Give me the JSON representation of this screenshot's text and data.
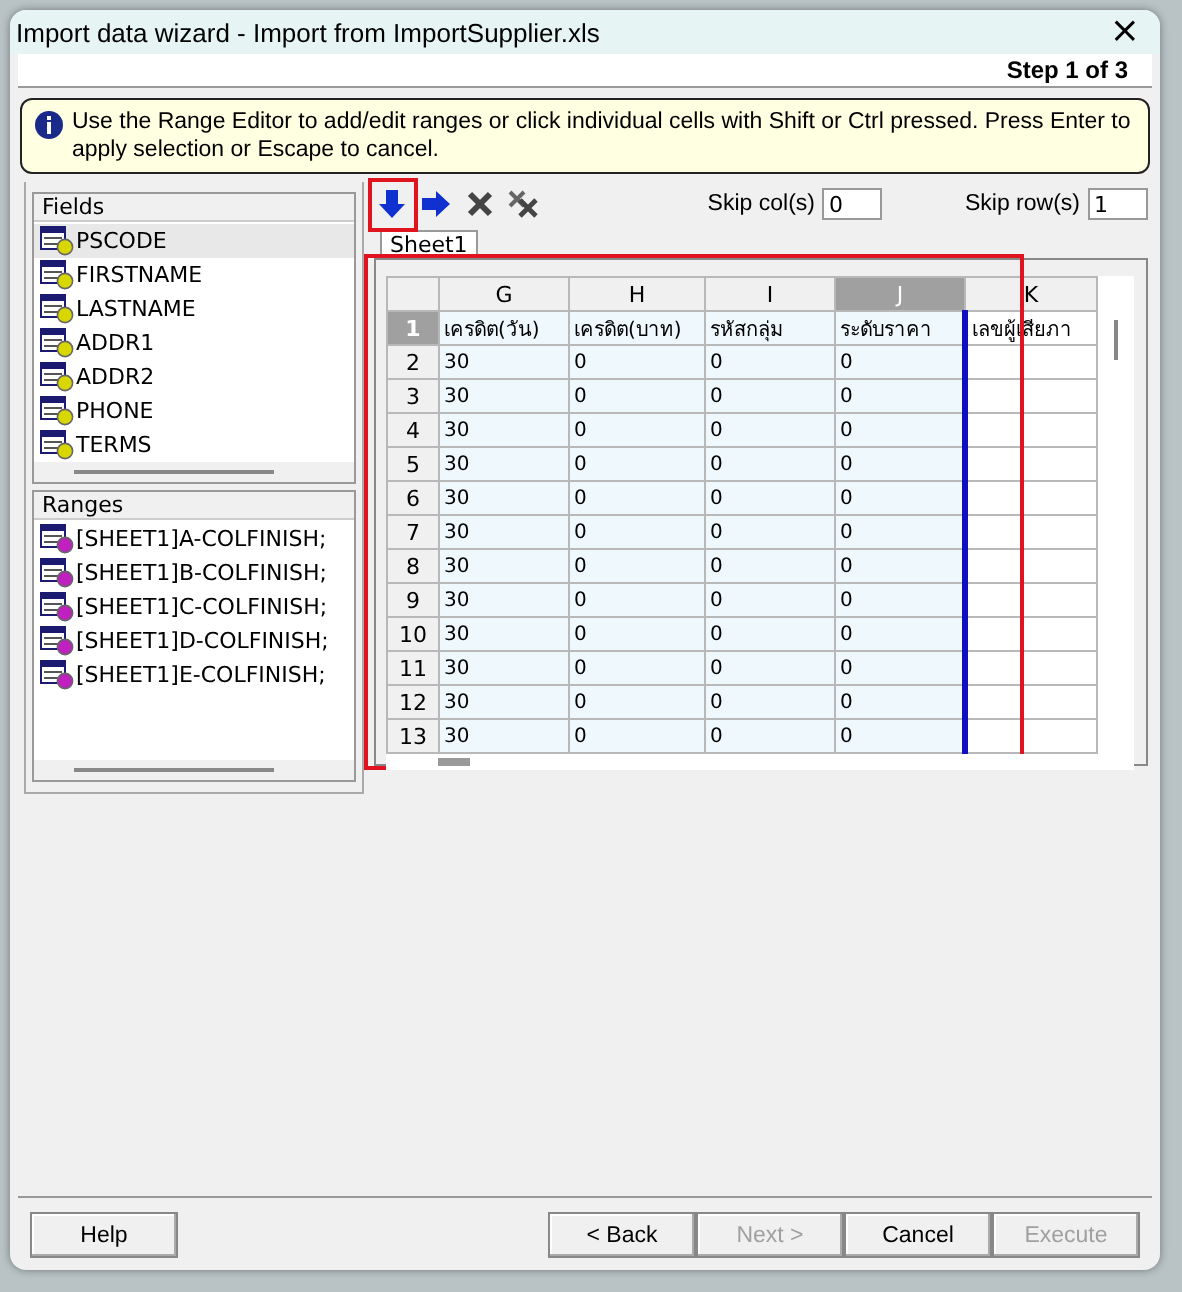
{
  "window": {
    "title": "Import data wizard - Import from ImportSupplier.xls",
    "close": "×"
  },
  "step": "Step 1 of 3",
  "info": "Use the Range Editor to add/edit ranges or click individual cells with Shift or Ctrl pressed. Press Enter to apply selection or Escape to cancel.",
  "fields": {
    "title": "Fields",
    "items": [
      {
        "label": "PSCODE",
        "selected": true
      },
      {
        "label": "FIRSTNAME",
        "selected": false
      },
      {
        "label": "LASTNAME",
        "selected": false
      },
      {
        "label": "ADDR1",
        "selected": false
      },
      {
        "label": "ADDR2",
        "selected": false
      },
      {
        "label": "PHONE",
        "selected": false
      },
      {
        "label": "TERMS",
        "selected": false
      }
    ]
  },
  "ranges": {
    "title": "Ranges",
    "items": [
      "[SHEET1]A-COLFINISH;",
      "[SHEET1]B-COLFINISH;",
      "[SHEET1]C-COLFINISH;",
      "[SHEET1]D-COLFINISH;",
      "[SHEET1]E-COLFINISH;"
    ]
  },
  "toolbar": {
    "skip_cols": {
      "label": "Skip col(s)",
      "value": "0"
    },
    "skip_rows": {
      "label": "Skip row(s)",
      "value": "1"
    }
  },
  "sheet_tabs": [
    {
      "label": "Sheet1",
      "selected": true
    }
  ],
  "grid": {
    "columns": [
      {
        "label": "G",
        "selected": false,
        "in_range": true
      },
      {
        "label": "H",
        "selected": false,
        "in_range": true
      },
      {
        "label": "I",
        "selected": false,
        "in_range": true
      },
      {
        "label": "J",
        "selected": true,
        "in_range": true
      },
      {
        "label": "K",
        "selected": false,
        "in_range": false
      }
    ],
    "rows": [
      {
        "header": "1",
        "selected": true,
        "cells": [
          "เครดิต(วัน)",
          "เครดิต(บาท)",
          "รหัสกลุ่ม",
          "ระดับราคา",
          "เลขผู้เสียภา"
        ]
      },
      {
        "header": "2",
        "selected": false,
        "cells": [
          "30",
          "0",
          "0",
          "0",
          ""
        ]
      },
      {
        "header": "3",
        "selected": false,
        "cells": [
          "30",
          "0",
          "0",
          "0",
          ""
        ]
      },
      {
        "header": "4",
        "selected": false,
        "cells": [
          "30",
          "0",
          "0",
          "0",
          ""
        ]
      },
      {
        "header": "5",
        "selected": false,
        "cells": [
          "30",
          "0",
          "0",
          "0",
          ""
        ]
      },
      {
        "header": "6",
        "selected": false,
        "cells": [
          "30",
          "0",
          "0",
          "0",
          ""
        ]
      },
      {
        "header": "7",
        "selected": false,
        "cells": [
          "30",
          "0",
          "0",
          "0",
          ""
        ]
      },
      {
        "header": "8",
        "selected": false,
        "cells": [
          "30",
          "0",
          "0",
          "0",
          ""
        ]
      },
      {
        "header": "9",
        "selected": false,
        "cells": [
          "30",
          "0",
          "0",
          "0",
          ""
        ]
      },
      {
        "header": "10",
        "selected": false,
        "cells": [
          "30",
          "0",
          "0",
          "0",
          ""
        ]
      },
      {
        "header": "11",
        "selected": false,
        "cells": [
          "30",
          "0",
          "0",
          "0",
          ""
        ]
      },
      {
        "header": "12",
        "selected": false,
        "cells": [
          "30",
          "0",
          "0",
          "0",
          ""
        ]
      },
      {
        "header": "13",
        "selected": false,
        "cells": [
          "30",
          "0",
          "0",
          "0",
          ""
        ]
      }
    ]
  },
  "buttons": [
    {
      "label": "Help",
      "disabled": false,
      "kind": "left"
    },
    {
      "label": "< Back",
      "disabled": false,
      "kind": "right"
    },
    {
      "label": "Next >",
      "disabled": true,
      "kind": "right"
    },
    {
      "label": "Cancel",
      "disabled": false,
      "kind": "right"
    },
    {
      "label": "Execute",
      "disabled": true,
      "kind": "right"
    }
  ]
}
